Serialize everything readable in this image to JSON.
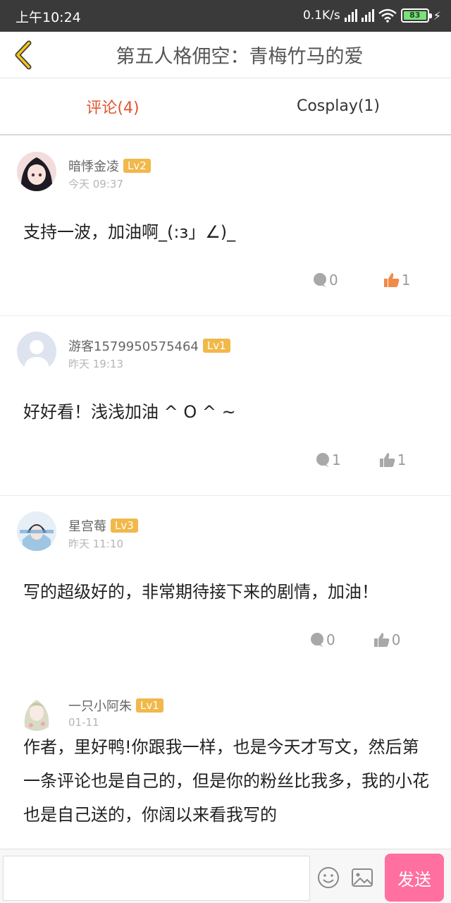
{
  "status_bar": {
    "time": "上午10:24",
    "network_speed": "0.1K/s",
    "battery": "83"
  },
  "header": {
    "back_icon": "chevron-left-icon",
    "title": "第五人格佣空：青梅竹马的爱"
  },
  "tabs": [
    {
      "label": "评论(4)",
      "active": true
    },
    {
      "label": "Cosplay(1)",
      "active": false
    }
  ],
  "comments": [
    {
      "username": "暗悸金凌",
      "level": "Lv2",
      "time": "今天 09:37",
      "text": "支持一波，加油啊_(:з」∠)_",
      "reply_count": "0",
      "like_count": "1",
      "liked": true
    },
    {
      "username": "游客1579950575464",
      "level": "Lv1",
      "time": "昨天 19:13",
      "text": "好好看！浅浅加油 ^ O ^ ~",
      "reply_count": "1",
      "like_count": "1",
      "liked": false
    },
    {
      "username": "星宫莓",
      "level": "Lv3",
      "time": "昨天 11:10",
      "text": "写的超级好的，非常期待接下来的剧情，加油！",
      "reply_count": "0",
      "like_count": "0",
      "liked": false
    },
    {
      "username": "一只小阿朱",
      "level": "Lv1",
      "time": "01-11",
      "text": "作者，里好鸭!你跟我一样，也是今天才写文，然后第一条评论也是自己的，但是你的粉丝比我多，我的小花也是自己送的，你阔以来看我写的",
      "reply_count": "",
      "like_count": "",
      "liked": false
    }
  ],
  "input_bar": {
    "placeholder": "",
    "send_label": "发送"
  },
  "colors": {
    "accent": "#e0552f",
    "level_badge": "#f1b84a",
    "send_button": "#ff6fa0",
    "like_active": "#f08a4b"
  }
}
